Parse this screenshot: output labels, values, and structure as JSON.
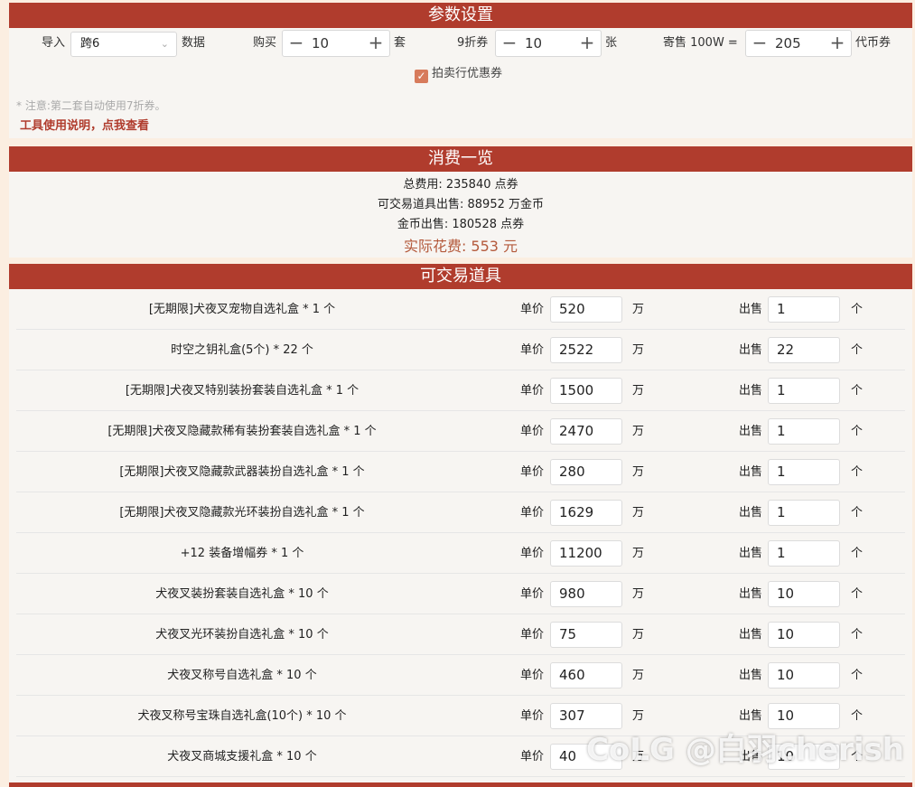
{
  "params": {
    "title": "参数设置",
    "import_label": "导入",
    "import_value": "跨6",
    "data_label": "数据",
    "buy_label": "购买",
    "buy_value": "10",
    "buy_unit": "套",
    "coupon_label": "9折券",
    "coupon_value": "10",
    "coupon_unit": "张",
    "consign_label": "寄售 100W =",
    "consign_value": "205",
    "consign_unit": "代币券",
    "auction_coupon_label": "拍卖行优惠券",
    "auction_coupon_checked": true,
    "note": "* 注意:第二套自动使用7折券。",
    "help_link": "工具使用说明，点我查看"
  },
  "summary": {
    "title": "消费一览",
    "total_cost": "总费用: 235840 点券",
    "tradable_sale": "可交易道具出售: 88952 万金币",
    "gold_sale": "金币出售: 180528 点券",
    "actual_cost": "实际花费: 553 元"
  },
  "items_section": {
    "title": "可交易道具",
    "price_label": "单价",
    "price_unit": "万",
    "sell_label": "出售",
    "sell_unit": "个",
    "rows": [
      {
        "name": "[无期限]犬夜叉宠物自选礼盒 * 1 个",
        "price": "520",
        "sell": "1"
      },
      {
        "name": "时空之钥礼盒(5个) * 22 个",
        "price": "2522",
        "sell": "22"
      },
      {
        "name": "[无期限]犬夜叉特别装扮套装自选礼盒 * 1 个",
        "price": "1500",
        "sell": "1"
      },
      {
        "name": "[无期限]犬夜叉隐藏款稀有装扮套装自选礼盒 * 1 个",
        "price": "2470",
        "sell": "1"
      },
      {
        "name": "[无期限]犬夜叉隐藏款武器装扮自选礼盒 * 1 个",
        "price": "280",
        "sell": "1"
      },
      {
        "name": "[无期限]犬夜叉隐藏款光环装扮自选礼盒 * 1 个",
        "price": "1629",
        "sell": "1"
      },
      {
        "name": "+12 装备增幅券 * 1 个",
        "price": "11200",
        "sell": "1"
      },
      {
        "name": "犬夜叉装扮套装自选礼盒 * 10 个",
        "price": "980",
        "sell": "10"
      },
      {
        "name": "犬夜叉光环装扮自选礼盒 * 10 个",
        "price": "75",
        "sell": "10"
      },
      {
        "name": "犬夜叉称号自选礼盒 * 10 个",
        "price": "460",
        "sell": "10"
      },
      {
        "name": "犬夜叉称号宝珠自选礼盒(10个) * 10 个",
        "price": "307",
        "sell": "10"
      },
      {
        "name": "犬夜叉商城支援礼盒 * 10 个",
        "price": "40",
        "sell": "10"
      }
    ]
  },
  "watermark": "CoLG @白羽cherish"
}
